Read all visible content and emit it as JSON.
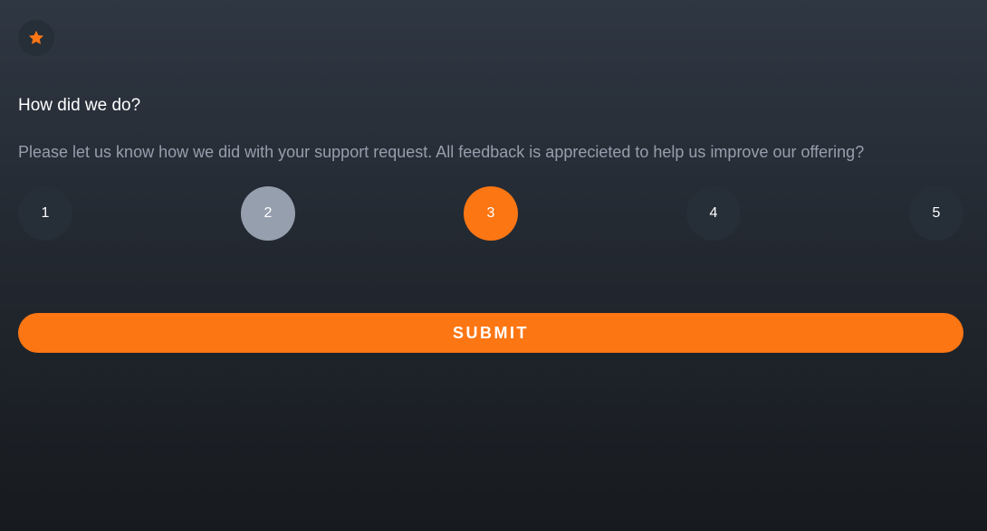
{
  "card": {
    "icon": "star-icon",
    "title": "How did we do?",
    "description": "Please let us know how we did with your support request. All feedback is apprecieted to help us improve our offering?"
  },
  "ratings": {
    "options": [
      "1",
      "2",
      "3",
      "4",
      "5"
    ],
    "selected": "3",
    "hovered": "2"
  },
  "submit": {
    "label": "SUBMIT"
  },
  "colors": {
    "accent": "#fc7614",
    "muted": "#969fad",
    "chip": "#262e38"
  }
}
